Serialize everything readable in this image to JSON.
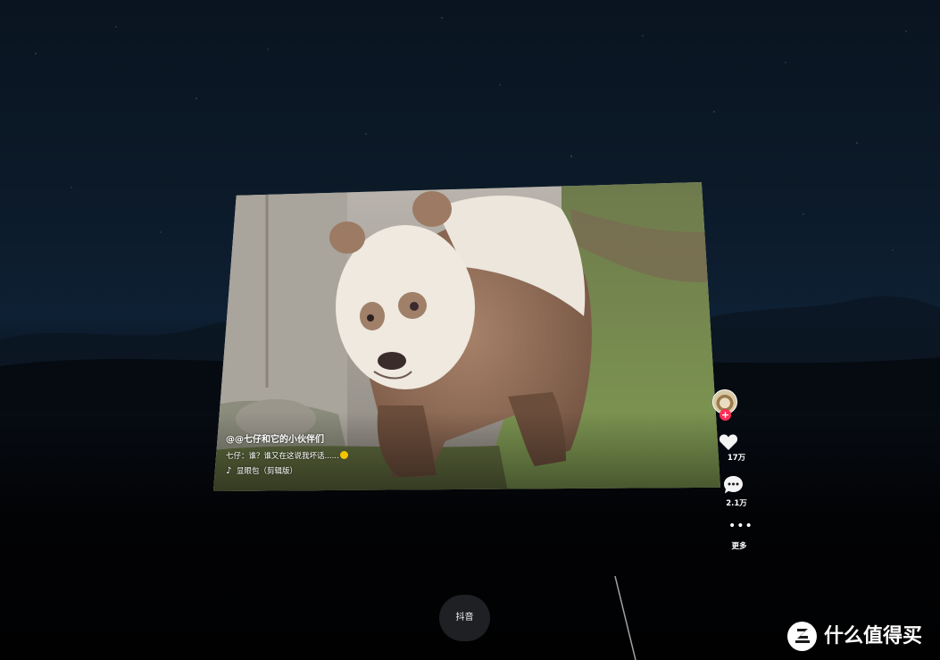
{
  "video": {
    "author": "@@七仔和它的小伙伴们",
    "caption": "七仔：谁？谁又在这说我坏话......",
    "music": "显眼包（剪辑版）"
  },
  "actions": {
    "like_count": "17万",
    "comment_count": "2.1万",
    "more_label": "更多"
  },
  "dock": {
    "app_label": "抖音"
  },
  "watermark": {
    "text": "什么值得买"
  },
  "icons": {
    "avatar": "avatar",
    "follow": "plus-badge-icon",
    "like": "heart-icon",
    "comment": "comment-bubble-icon",
    "more": "ellipsis-icon",
    "music": "music-note-icon",
    "watermark_logo": "zhi-logo-icon"
  },
  "colors": {
    "follow_badge": "#fe2c55",
    "dock_pill": "#1e2024"
  }
}
